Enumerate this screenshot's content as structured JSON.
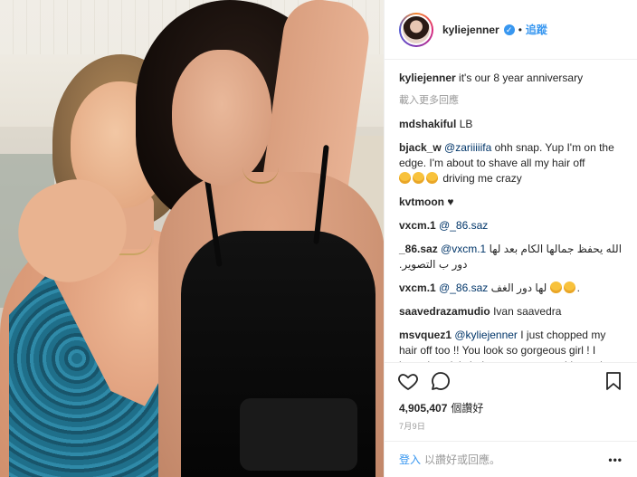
{
  "header": {
    "username": "kyliejenner",
    "verified_mark": "✓",
    "separator": "•",
    "follow_label": "追蹤"
  },
  "comments": [
    {
      "user": "kyliejenner",
      "text": "it's our 8 year anniversary"
    },
    {
      "load_more": "載入更多回應"
    },
    {
      "user": "mdshakiful",
      "text": "LB"
    },
    {
      "user": "bjack_w",
      "mention": "@zariiiiifa",
      "text": "ohh snap. Yup I'm on the edge. I'm about to shave all my hair off",
      "emoji_count": 3,
      "tail": "driving me crazy"
    },
    {
      "user": "kvtmoon",
      "text": "♥"
    },
    {
      "user": "vxcm.1",
      "mention": "@_86.saz",
      "text": ""
    },
    {
      "user": "_86.saz",
      "mention": "@vxcm.1",
      "text": "الله يحفظ جمالها الكام بعد لها دور ب التصوير."
    },
    {
      "user": "vxcm.1",
      "mention": "@_86.saz",
      "text": "لها دور الغف",
      "emoji_count": 2,
      "tail": "."
    },
    {
      "user": "saavedrazamudio",
      "text": "Ivan saavedra"
    },
    {
      "user": "msvquez1",
      "mention": "@kyliejenner",
      "text": "I just chopped my hair off too !! You look so gorgeous girl ! I know how it is being a new mom , I have three now my self and I'm only 27 ! Your doing a wonderful job , and stormi is sooo gorgeous ! @kyliejenner"
    }
  ],
  "actions": {
    "like_icon": "heart-icon",
    "comment_icon": "comment-icon",
    "save_icon": "bookmark-icon"
  },
  "likes": {
    "count": "4,905,407",
    "label": "個讚好"
  },
  "date": "7月9日",
  "login": {
    "link": "登入",
    "rest": "以讚好或回應。",
    "menu": "•••"
  },
  "colors": {
    "accent": "#3897f0",
    "text": "#262626",
    "muted": "#999999",
    "mention": "#003569"
  }
}
